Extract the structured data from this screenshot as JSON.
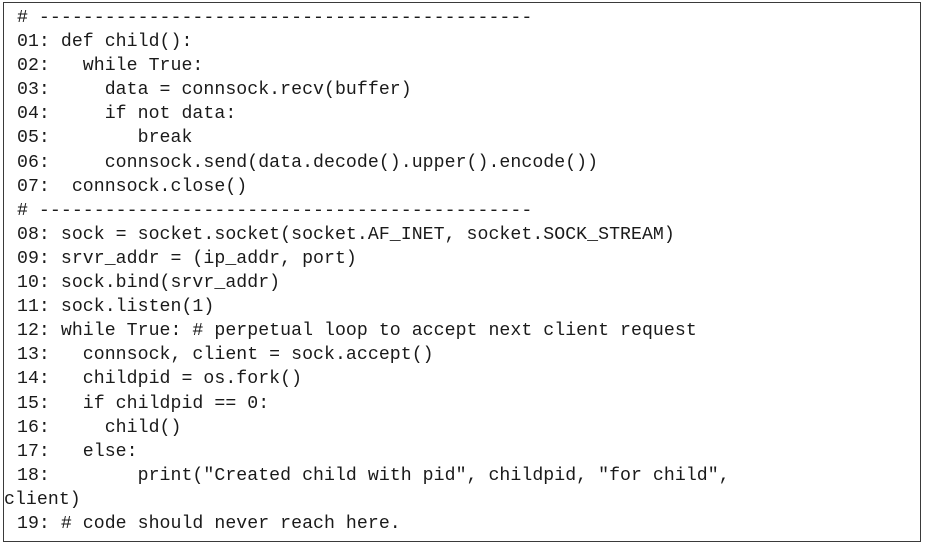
{
  "code": {
    "lines": [
      "# ---------------------------------------------",
      "01: def child():",
      "02:   while True:",
      "03:     data = connsock.recv(buffer)",
      "04:     if not data:",
      "05:        break",
      "06:     connsock.send(data.decode().upper().encode())",
      "07:  connsock.close()",
      "# ---------------------------------------------",
      "08: sock = socket.socket(socket.AF_INET, socket.SOCK_STREAM)",
      "09: srvr_addr = (ip_addr, port)",
      "10: sock.bind(srvr_addr)",
      "11: sock.listen(1)",
      "12: while True: # perpetual loop to accept next client request",
      "13:   connsock, client = sock.accept()",
      "14:   childpid = os.fork()",
      "15:   if childpid == 0:",
      "16:     child()",
      "17:   else:",
      "18:        print(\"Created child with pid\", childpid, \"for child\",",
      "client)",
      "19: # code should never reach here."
    ]
  }
}
